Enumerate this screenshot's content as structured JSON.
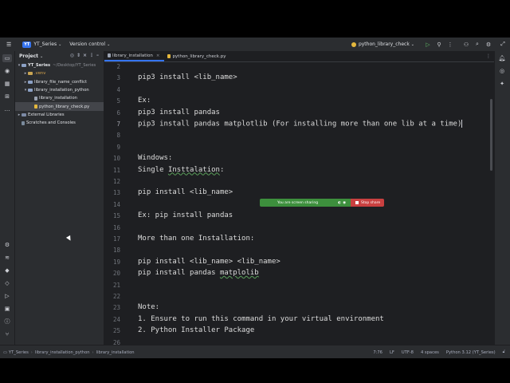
{
  "titlebar": {
    "project_badge": "YT",
    "project_name": "YT_Series",
    "vcs": "Version control",
    "run_config": "python_library_check"
  },
  "project_panel": {
    "title": "Project",
    "tree": [
      {
        "label": "YT_Series",
        "hint": "~/Desktop/YT_Series",
        "depth": 0,
        "kind": "folder",
        "arrow": "▾"
      },
      {
        "label": ".venv",
        "depth": 1,
        "kind": "folder-orange",
        "arrow": "▸"
      },
      {
        "label": "library_file_name_conflict",
        "depth": 1,
        "kind": "folder",
        "arrow": "▸"
      },
      {
        "label": "library_installation_python",
        "depth": 1,
        "kind": "folder",
        "arrow": "▾"
      },
      {
        "label": "library_installation",
        "depth": 2,
        "kind": "file"
      },
      {
        "label": "python_library_check.py",
        "depth": 2,
        "kind": "py",
        "selected": true
      },
      {
        "label": "External Libraries",
        "depth": 0,
        "kind": "lib",
        "arrow": "▸"
      },
      {
        "label": "Scratches and Consoles",
        "depth": 0,
        "kind": "scratch"
      }
    ]
  },
  "editor": {
    "tabs": [
      {
        "label": "library_installation",
        "active": true
      },
      {
        "label": "python_library_check.py",
        "active": false
      }
    ],
    "lines": [
      {
        "n": "2",
        "text": ""
      },
      {
        "n": "3",
        "text": "pip3 install <lib_name>"
      },
      {
        "n": "4",
        "text": ""
      },
      {
        "n": "5",
        "text": "Ex:"
      },
      {
        "n": "6",
        "text": "pip3 install pandas"
      },
      {
        "n": "7",
        "text": "pip3 install pandas matplotlib (For installing more than one lib at a time)",
        "current": true
      },
      {
        "n": "8",
        "text": ""
      },
      {
        "n": "9",
        "text": ""
      },
      {
        "n": "10",
        "text": "Windows:"
      },
      {
        "n": "11",
        "text": "Single Insttalation:"
      },
      {
        "n": "12",
        "text": ""
      },
      {
        "n": "13",
        "text": "pip install <lib_name>"
      },
      {
        "n": "14",
        "text": ""
      },
      {
        "n": "15",
        "text": "Ex: pip install pandas"
      },
      {
        "n": "16",
        "text": ""
      },
      {
        "n": "17",
        "text": "More than one Installation:"
      },
      {
        "n": "18",
        "text": ""
      },
      {
        "n": "19",
        "text": "pip install <lib_name> <lib_name>"
      },
      {
        "n": "20",
        "text": "pip install pandas matplolib"
      },
      {
        "n": "21",
        "text": ""
      },
      {
        "n": "22",
        "text": ""
      },
      {
        "n": "23",
        "text": "Note:"
      },
      {
        "n": "24",
        "text": "1. Ensure to run this command in your virtual environment"
      },
      {
        "n": "25",
        "text": "2. Python Installer Package"
      },
      {
        "n": "26",
        "text": ""
      }
    ]
  },
  "share_banner": {
    "message": "You are screen sharing",
    "stop_label": "Stop share"
  },
  "statusbar": {
    "breadcrumbs": [
      "YT_Series",
      "library_installation_python",
      "library_installation"
    ],
    "position": "7:76",
    "line_ending": "LF",
    "encoding": "UTF-8",
    "indent": "4 spaces",
    "interpreter": "Python 3.12 (YT_Series)"
  },
  "colors": {
    "accent": "#3574f0",
    "share_green": "#3d8f3d",
    "share_red": "#c94040"
  }
}
